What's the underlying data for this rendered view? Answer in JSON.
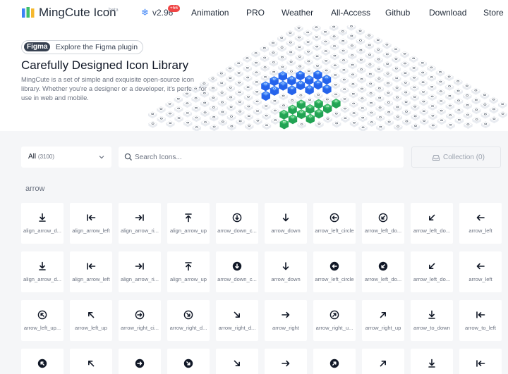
{
  "nav": {
    "brand": "MingCute Icon",
    "beta": "beta",
    "version": "v2.96",
    "version_badge": "+56",
    "links": [
      "Animation",
      "PRO",
      "Weather",
      "All-Access",
      "Github",
      "Download",
      "Store"
    ]
  },
  "hero": {
    "figma_tag": "Figma",
    "figma_text": "Explore the Figma plugin",
    "title": "Carefully Designed Icon Library",
    "description": "MingCute is a set of simple and exquisite open-source icon library. Whether you're a designer or a developer, it's perfect for use in web and mobile."
  },
  "filter": {
    "category": "All",
    "category_count": "(3100)",
    "search_placeholder": "Search Icons...",
    "collection": "Collection (0)"
  },
  "section": {
    "label": "arrow"
  },
  "icons": [
    {
      "label": "align_arrow_d...",
      "icon": "align-arrow-down-icon"
    },
    {
      "label": "align_arrow_left",
      "icon": "align-arrow-left-icon"
    },
    {
      "label": "align_arrow_ri...",
      "icon": "align-arrow-right-icon"
    },
    {
      "label": "align_arrow_up",
      "icon": "align-arrow-up-icon"
    },
    {
      "label": "arrow_down_c...",
      "icon": "arrow-down-circle-icon"
    },
    {
      "label": "arrow_down",
      "icon": "arrow-down-icon"
    },
    {
      "label": "arrow_left_circle",
      "icon": "arrow-left-circle-icon"
    },
    {
      "label": "arrow_left_do...",
      "icon": "arrow-left-down-circle-icon"
    },
    {
      "label": "arrow_left_do...",
      "icon": "arrow-left-down-icon"
    },
    {
      "label": "arrow_left",
      "icon": "arrow-left-icon"
    },
    {
      "label": "align_arrow_d...",
      "icon": "align-arrow-down-fill-icon"
    },
    {
      "label": "align_arrow_left",
      "icon": "align-arrow-left-fill-icon"
    },
    {
      "label": "align_arrow_ri...",
      "icon": "align-arrow-right-fill-icon"
    },
    {
      "label": "align_arrow_up",
      "icon": "align-arrow-up-fill-icon"
    },
    {
      "label": "arrow_down_c...",
      "icon": "arrow-down-circle-fill-icon"
    },
    {
      "label": "arrow_down",
      "icon": "arrow-down-fill-icon"
    },
    {
      "label": "arrow_left_circle",
      "icon": "arrow-left-circle-fill-icon"
    },
    {
      "label": "arrow_left_do...",
      "icon": "arrow-left-down-circle-fill-icon"
    },
    {
      "label": "arrow_left_do...",
      "icon": "arrow-left-down-fill-icon"
    },
    {
      "label": "arrow_left",
      "icon": "arrow-left-fill-icon"
    },
    {
      "label": "arrow_left_up...",
      "icon": "arrow-left-up-circle-icon"
    },
    {
      "label": "arrow_left_up",
      "icon": "arrow-left-up-icon"
    },
    {
      "label": "arrow_right_ci...",
      "icon": "arrow-right-circle-icon"
    },
    {
      "label": "arrow_right_d...",
      "icon": "arrow-right-down-circle-icon"
    },
    {
      "label": "arrow_right_d...",
      "icon": "arrow-right-down-icon"
    },
    {
      "label": "arrow_right",
      "icon": "arrow-right-icon"
    },
    {
      "label": "arrow_right_u...",
      "icon": "arrow-right-up-circle-icon"
    },
    {
      "label": "arrow_right_up",
      "icon": "arrow-right-up-icon"
    },
    {
      "label": "arrow_to_down",
      "icon": "arrow-to-down-icon"
    },
    {
      "label": "arrow_to_left",
      "icon": "arrow-to-left-icon"
    },
    {
      "label": "",
      "icon": "arrow-left-up-circle-fill-icon"
    },
    {
      "label": "",
      "icon": "arrow-left-up-fill-icon"
    },
    {
      "label": "",
      "icon": "arrow-right-circle-fill-icon"
    },
    {
      "label": "",
      "icon": "arrow-right-down-circle-fill-icon"
    },
    {
      "label": "",
      "icon": "arrow-right-down-fill-icon"
    },
    {
      "label": "",
      "icon": "arrow-right-fill-icon"
    },
    {
      "label": "",
      "icon": "arrow-right-up-circle-fill-icon"
    },
    {
      "label": "",
      "icon": "arrow-right-up-fill-icon"
    },
    {
      "label": "",
      "icon": "arrow-to-down-fill-icon"
    },
    {
      "label": "",
      "icon": "arrow-to-left-fill-icon"
    }
  ],
  "colors": {
    "accent": "#3b82f6",
    "badge": "#ef4444",
    "iso_blue": "#3b82f6",
    "iso_green": "#3fbf6b",
    "iso_orange": "#f5b82e",
    "text_dark": "#111827",
    "text_muted": "#6b7280"
  }
}
